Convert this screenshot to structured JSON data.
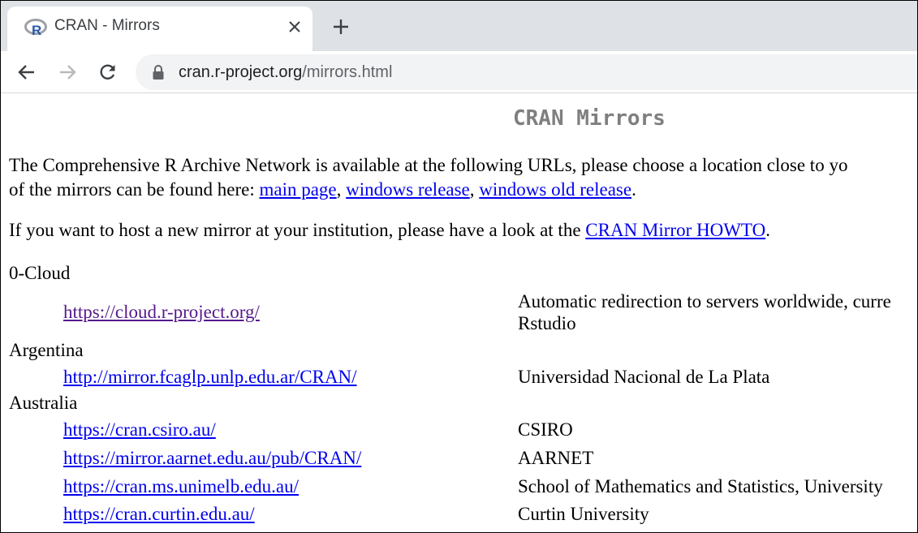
{
  "browser": {
    "tab": {
      "title": "CRAN - Mirrors",
      "favicon": "r-logo-icon"
    },
    "address": {
      "host": "cran.r-project.org",
      "path": "/mirrors.html"
    }
  },
  "page": {
    "heading": "CRAN Mirrors",
    "intro": {
      "line1": "The Comprehensive R Archive Network is available at the following URLs, please choose a location close to yo",
      "line2_prefix": "of the mirrors can be found here: ",
      "links": [
        "main page",
        "windows release",
        "windows old release"
      ],
      "sep": ", ",
      "end": "."
    },
    "host_text": {
      "prefix": "If you want to host a new mirror at your institution, please have a look at the ",
      "link": "CRAN Mirror HOWTO",
      "suffix": "."
    },
    "sections": [
      {
        "country": "0-Cloud",
        "mirrors": [
          {
            "url": "https://cloud.r-project.org/",
            "desc_line1": "Automatic redirection to servers worldwide, curre",
            "desc_line2": "Rstudio",
            "visited": true
          }
        ]
      },
      {
        "country": "Argentina",
        "mirrors": [
          {
            "url": "http://mirror.fcaglp.unlp.edu.ar/CRAN/",
            "desc_line1": "Universidad Nacional de La Plata",
            "desc_line2": ""
          }
        ]
      },
      {
        "country": "Australia",
        "mirrors": [
          {
            "url": "https://cran.csiro.au/",
            "desc_line1": "CSIRO",
            "desc_line2": ""
          },
          {
            "url": "https://mirror.aarnet.edu.au/pub/CRAN/",
            "desc_line1": "AARNET",
            "desc_line2": ""
          },
          {
            "url": "https://cran.ms.unimelb.edu.au/",
            "desc_line1": "School of Mathematics and Statistics, University",
            "desc_line2": ""
          },
          {
            "url": "https://cran.curtin.edu.au/",
            "desc_line1": "Curtin University",
            "desc_line2": ""
          }
        ]
      }
    ]
  },
  "colors": {
    "link": "#0000ee",
    "visited_link": "#551a8b",
    "heading": "#7f7f7f",
    "tabstrip": "#dee1e6",
    "omnibox": "#f1f3f4"
  }
}
